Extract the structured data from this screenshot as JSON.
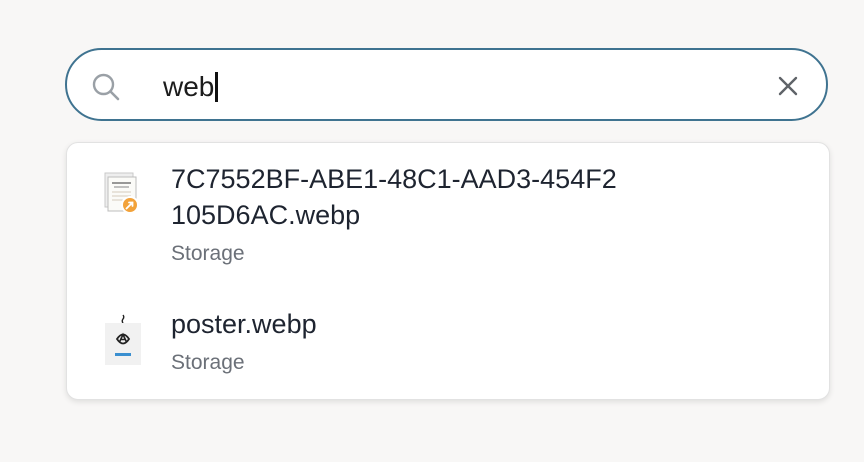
{
  "search": {
    "query": "web"
  },
  "results": [
    {
      "name": "7C7552BF-ABE1-48C1-AAD3-454F2105D6AC.webp",
      "source": "Storage",
      "thumbnail": "converted-note-icon"
    },
    {
      "name": "poster.webp",
      "source": "Storage",
      "thumbnail": "poster-file-icon"
    }
  ],
  "colors": {
    "search_border": "#3f7390",
    "background": "#f8f7f6",
    "text_primary": "#1e2430",
    "text_secondary": "#6b7078"
  }
}
